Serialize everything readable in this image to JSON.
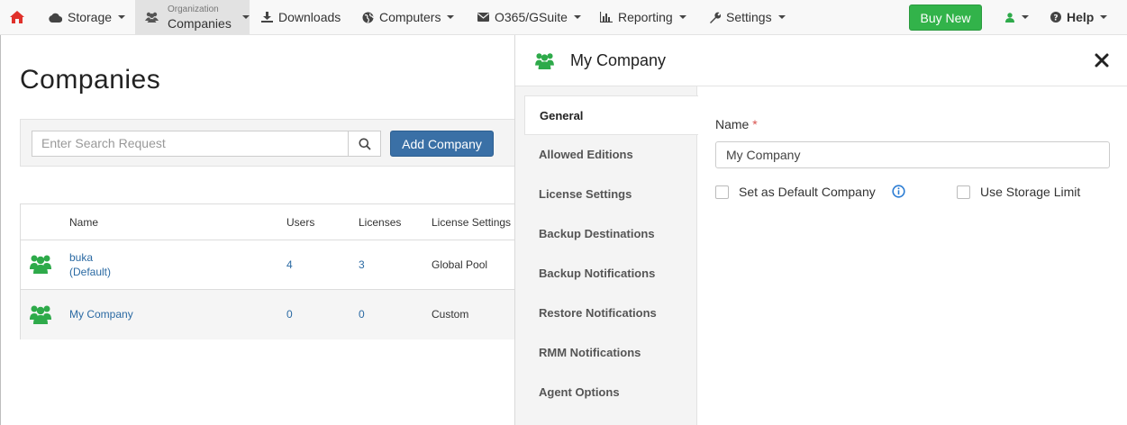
{
  "nav": {
    "storage": "Storage",
    "org_small": "Organization",
    "org_big": "Companies",
    "downloads": "Downloads",
    "computers": "Computers",
    "o365": "O365/GSuite",
    "reporting": "Reporting",
    "settings": "Settings",
    "buy_new": "Buy New",
    "help": "Help"
  },
  "page": {
    "title": "Companies",
    "search_placeholder": "Enter Search Request",
    "add_company": "Add Company"
  },
  "table": {
    "headers": {
      "name": "Name",
      "users": "Users",
      "licenses": "Licenses",
      "license_settings": "License Settings"
    },
    "rows": [
      {
        "name": "buka",
        "tag": "(Default)",
        "users": "4",
        "licenses": "3",
        "license_settings": "Global Pool"
      },
      {
        "name": "My Company",
        "tag": "",
        "users": "0",
        "licenses": "0",
        "license_settings": "Custom"
      }
    ]
  },
  "panel": {
    "title": "My Company",
    "tabs": [
      "General",
      "Allowed Editions",
      "License Settings",
      "Backup Destinations",
      "Backup Notifications",
      "Restore Notifications",
      "RMM Notifications",
      "Agent Options"
    ],
    "name_label": "Name",
    "required_mark": "*",
    "name_value": "My Company",
    "default_company_label": "Set as Default Company",
    "storage_limit_label": "Use Storage Limit"
  },
  "colors": {
    "accent_blue": "#3a70a6",
    "buy_green": "#32b34a",
    "company_icon_green": "#2eaa4a",
    "home_red": "#e0312b"
  },
  "icons": [
    "home-icon",
    "cloud-icon",
    "users-icon",
    "download-icon",
    "globe-icon",
    "envelope-icon",
    "bar-chart-icon",
    "wrench-icon",
    "user-icon",
    "question-icon",
    "search-icon",
    "close-icon",
    "info-icon"
  ]
}
